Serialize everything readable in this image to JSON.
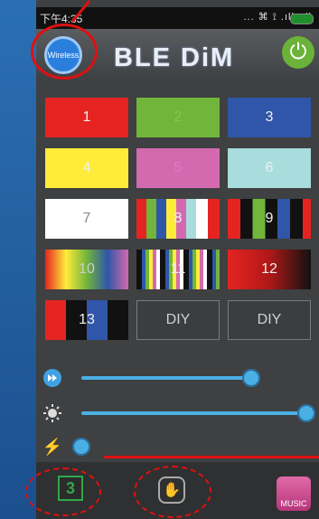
{
  "status": {
    "time": "下午4:35",
    "icons": "... ⌘ ⟟ .ıll .ıll"
  },
  "header": {
    "title": "BLE DiM",
    "wireless_label": "Wireless"
  },
  "buttons": [
    {
      "label": "1"
    },
    {
      "label": "2"
    },
    {
      "label": "3"
    },
    {
      "label": "4"
    },
    {
      "label": "5"
    },
    {
      "label": "6"
    },
    {
      "label": "7"
    },
    {
      "label": "8"
    },
    {
      "label": "9"
    },
    {
      "label": "10"
    },
    {
      "label": "11"
    },
    {
      "label": "12"
    },
    {
      "label": "13"
    },
    {
      "label": "DIY"
    },
    {
      "label": "DIY"
    }
  ],
  "sliders": {
    "speed": {
      "value_pct": 77
    },
    "brightness": {
      "value_pct": 100
    },
    "power": {
      "value_pct": 0
    }
  },
  "bottom": {
    "tab_number": "3",
    "music_label": "MUSIC"
  },
  "colors": {
    "accent_blue": "#4ab0e4",
    "power_green": "#6ab338",
    "annotation_red": "#e01010"
  }
}
